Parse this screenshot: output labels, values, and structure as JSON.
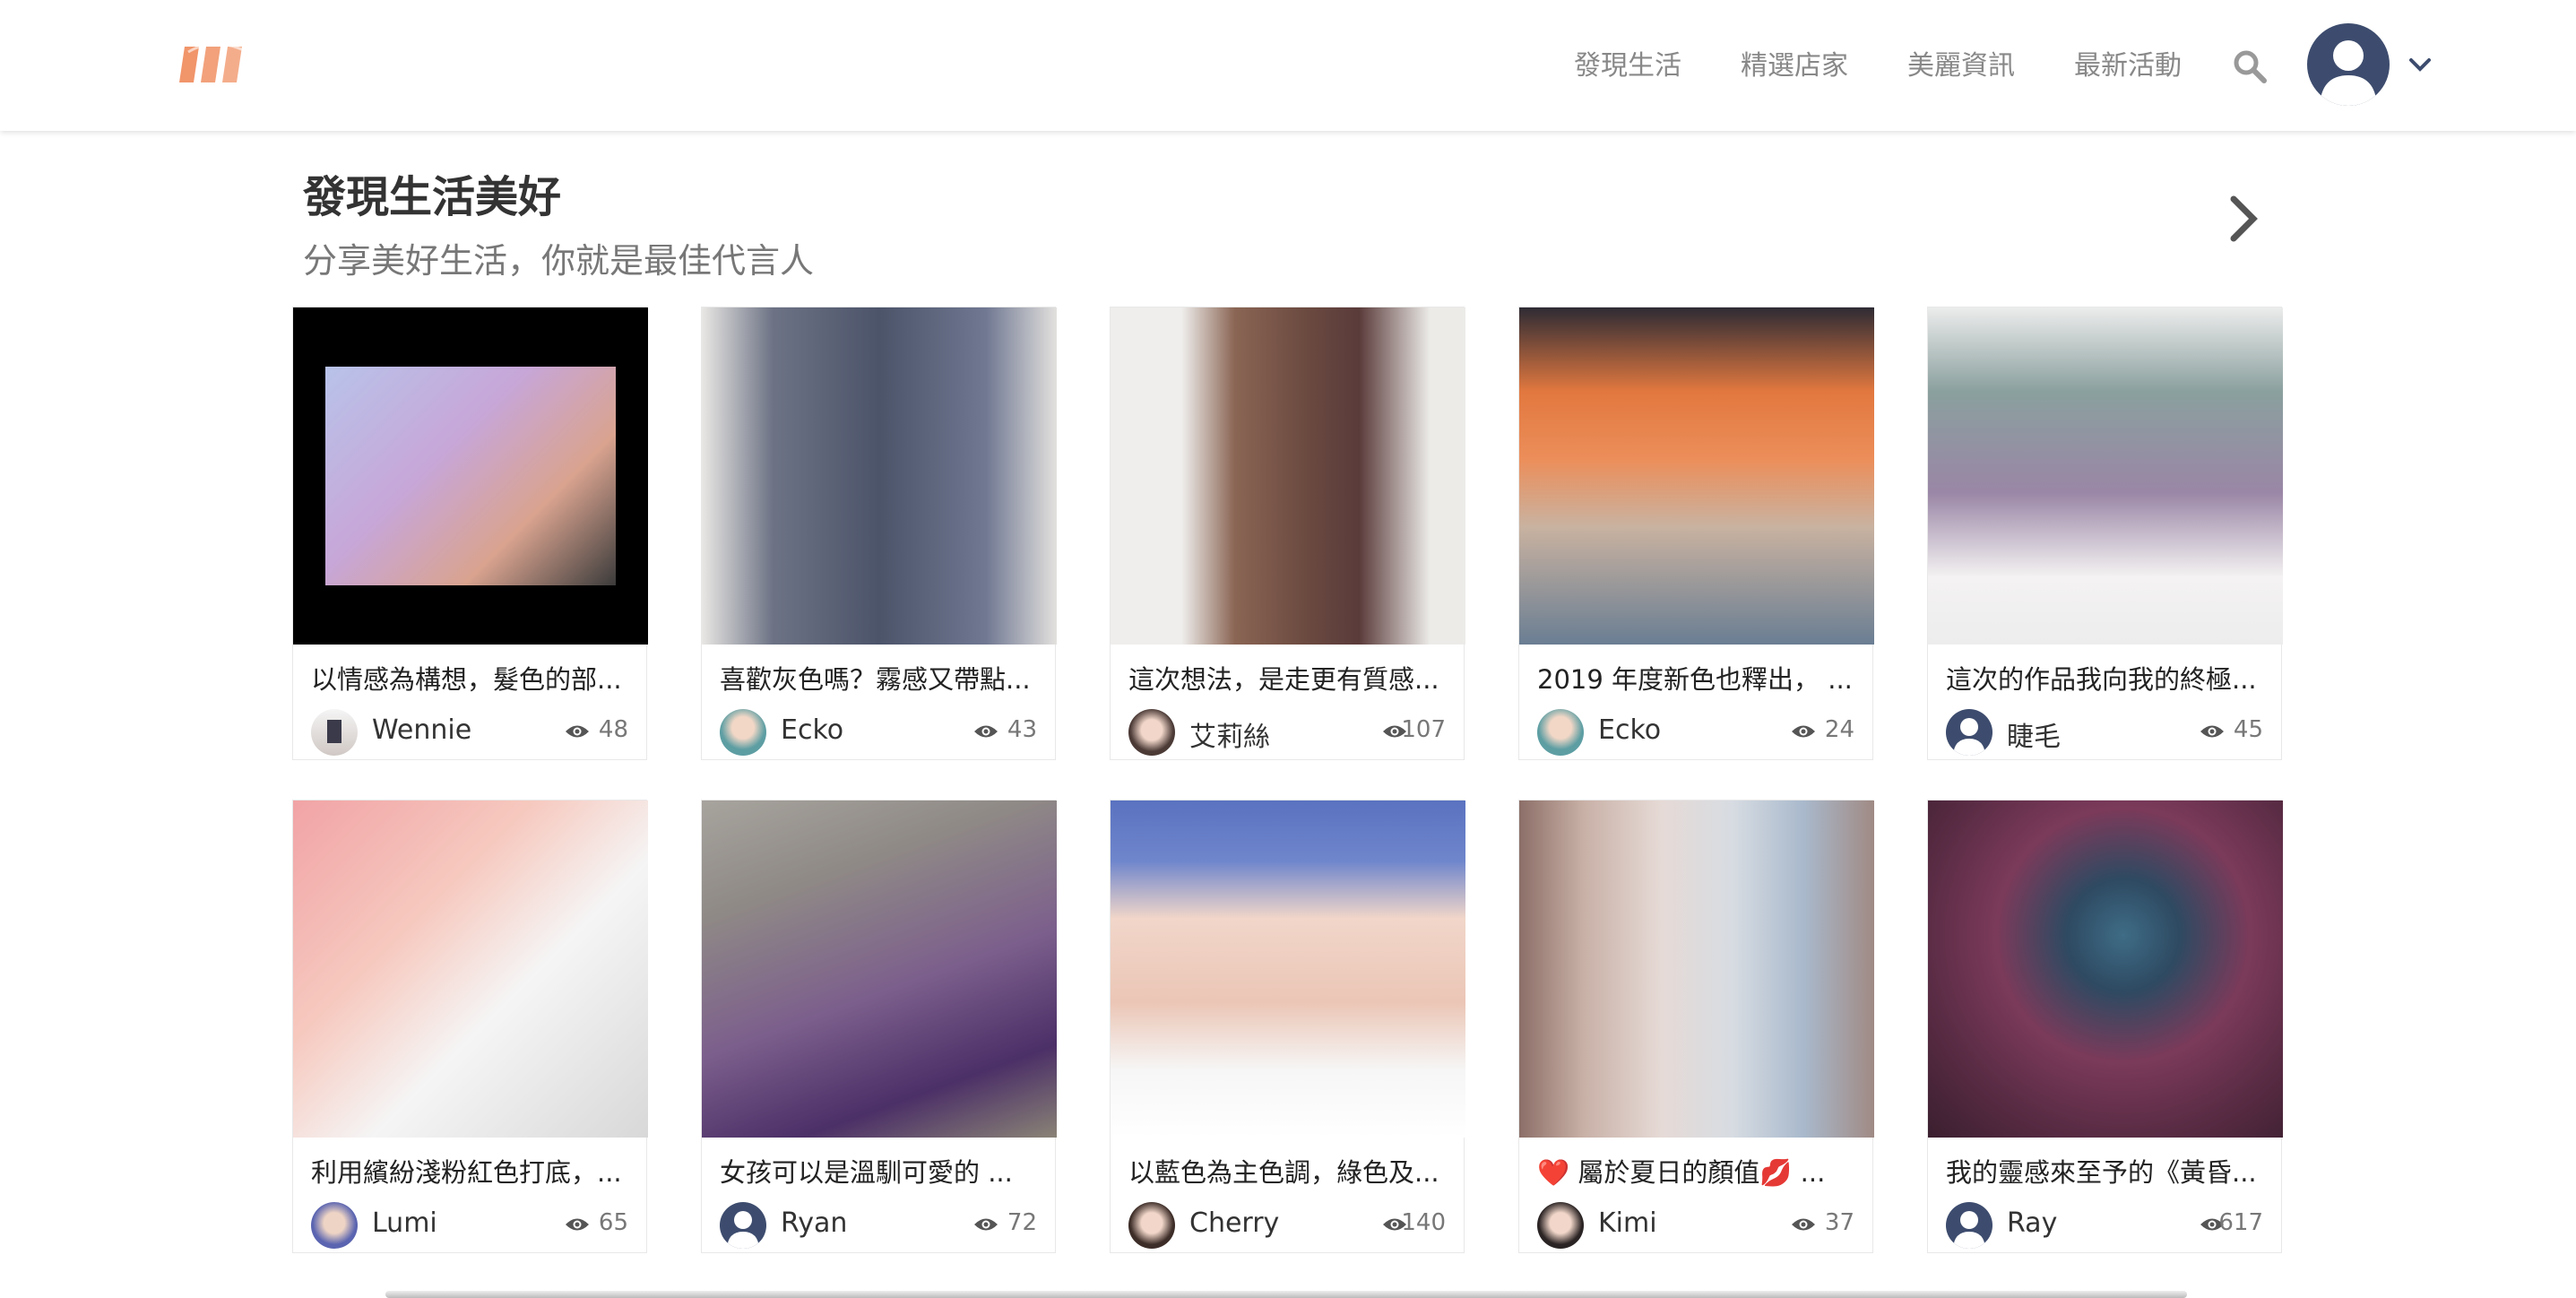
{
  "nav": {
    "items": [
      "發現生活",
      "精選店家",
      "美麗資訊",
      "最新活動"
    ]
  },
  "colors": {
    "brand": "#ef8a5a",
    "avatar_default": "#3d4c6e"
  },
  "icons": {
    "logo": "brand-logo-icon",
    "search": "search-icon",
    "dropdown": "chevron-down-icon",
    "next": "chevron-right-icon",
    "views": "eye-icon"
  },
  "section": {
    "title": "發現生活美好",
    "subtitle": "分享美好生活，你就是最佳代言人"
  },
  "cards": [
    {
      "caption": "以情感為構想，髮色的部...",
      "author": "Wennie",
      "views": "48"
    },
    {
      "caption": "喜歡灰色嗎？霧感又帶點...",
      "author": "Ecko",
      "views": "43"
    },
    {
      "caption": "這次想法，是走更有質感...",
      "author": "艾莉絲",
      "views": "107"
    },
    {
      "caption": "2019 年度新色也釋出， ...",
      "author": "Ecko",
      "views": "24"
    },
    {
      "caption": "這次的作品我向我的終極...",
      "author": "睫毛",
      "views": "45"
    },
    {
      "caption": "利用繽紛淺粉紅色打底，...",
      "author": "Lumi",
      "views": "65"
    },
    {
      "caption": "女孩可以是溫馴可愛的 ...",
      "author": "Ryan",
      "views": "72"
    },
    {
      "caption": "以藍色為主色調，綠色及...",
      "author": "Cherry",
      "views": "140"
    },
    {
      "caption": "❤️ 屬於夏日的顏值💋  ...",
      "author": "Kimi",
      "views": "37"
    },
    {
      "caption": "我的靈感來至予的《黃昏...",
      "author": "Ray",
      "views": "617"
    }
  ]
}
